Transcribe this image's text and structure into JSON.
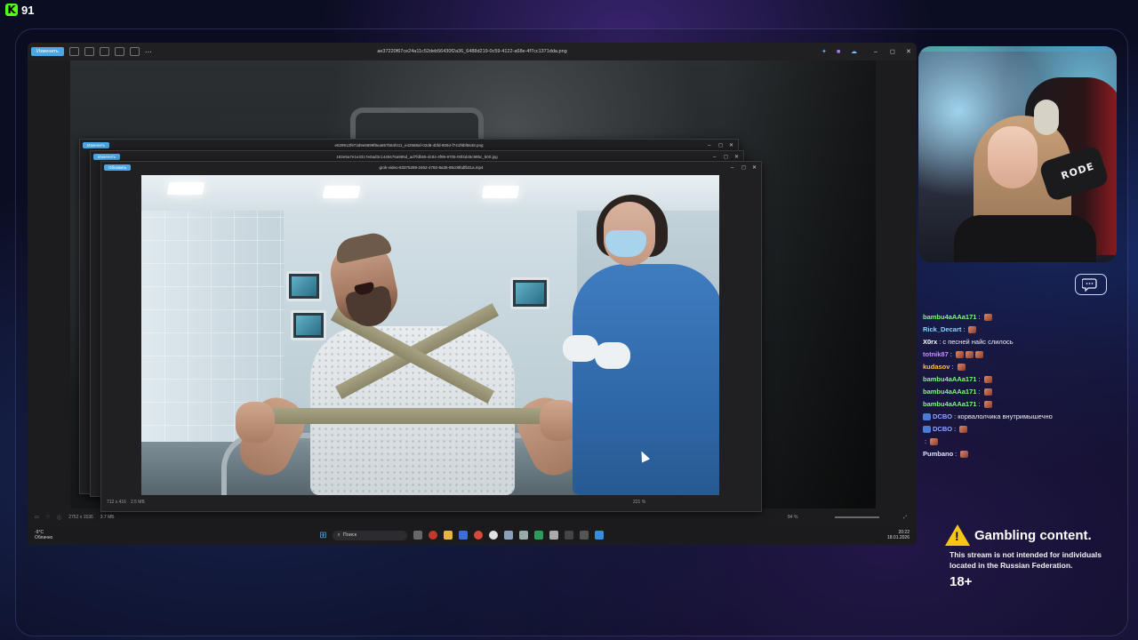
{
  "brand": {
    "logo_letter": "K",
    "viewer_count": "91"
  },
  "main_viewer": {
    "edit_label": "Изменить",
    "title": "ae37220f67ce24a11c52deb56430f2a36_6488d219-0c59-4122-a68e-4f7cc1371dda.png",
    "status_dims": "2752 x 1536",
    "status_size": "3.7 МБ",
    "zoom": "84 %"
  },
  "window_b": {
    "edit_label": "Изменить",
    "title": "e529912f973d9e8899f8ea857b84f411_e42588af-02d8-4bfd-8094-f741f8bf6648.png"
  },
  "window_c": {
    "edit_label": "Изменить",
    "title": "182e5a7e1e3317e0ad3c1449476a995d_ad7fdb55-dc84-4f99-9705-00f4d45c985c_500.jpg"
  },
  "window_d": {
    "edit_label": "Обновить",
    "title": "grok-video-83375289-2462-4782-8a35-85c00bdfb31a.mp4",
    "status_dims": "712 x 416",
    "status_size": "2.5 МБ",
    "zoom": "221 %"
  },
  "taskbar": {
    "weather_temp": "-9°C",
    "weather_desc": "Облачно",
    "search_placeholder": "Поиск",
    "time": "20:22",
    "date": "18.01.2026"
  },
  "webcam": {
    "mic_brand": "RODE"
  },
  "chat": [
    {
      "user": "bambu4aAAa171",
      "color": "#7CFC7C",
      "message": "",
      "emotes": 1,
      "badge": false
    },
    {
      "user": "Rick_Decart",
      "color": "#8FD3FF",
      "message": "",
      "emotes": 1,
      "badge": false
    },
    {
      "user": "X0rx",
      "color": "#FFFFFF",
      "message": "с песней найс слилось",
      "emotes": 0,
      "badge": false
    },
    {
      "user": "totnik87",
      "color": "#C58CFF",
      "message": "",
      "emotes": 3,
      "badge": false
    },
    {
      "user": "kudasov",
      "color": "#FFC24A",
      "message": "",
      "emotes": 1,
      "badge": false
    },
    {
      "user": "bambu4aAAa171",
      "color": "#7CFC7C",
      "message": "",
      "emotes": 1,
      "badge": false
    },
    {
      "user": "bambu4aAAa171",
      "color": "#7CFC7C",
      "message": "",
      "emotes": 1,
      "badge": false
    },
    {
      "user": "bambu4aAAa171",
      "color": "#7CFC7C",
      "message": "",
      "emotes": 1,
      "badge": false
    },
    {
      "user": "DCBO",
      "color": "#8FA8FF",
      "message": "корвалолчика внутримышечно",
      "emotes": 0,
      "badge": true
    },
    {
      "user": "DCBO",
      "color": "#8FA8FF",
      "message": "",
      "emotes": 1,
      "badge": true
    },
    {
      "user": "",
      "color": "#E0303A",
      "message": "",
      "emotes": 1,
      "badge": false
    },
    {
      "user": "Pumbano",
      "color": "#DDE3FF",
      "message": "",
      "emotes": 1,
      "badge": false
    }
  ],
  "notice": {
    "title": "Gambling content.",
    "body_line1": "This stream is not intended for individuals",
    "body_line2": "located in the Russian Federation.",
    "age": "18+"
  },
  "colors": {
    "kick_green": "#53FC18",
    "edit_blue": "#4AA8E6",
    "warning_yellow": "#F5C518"
  }
}
